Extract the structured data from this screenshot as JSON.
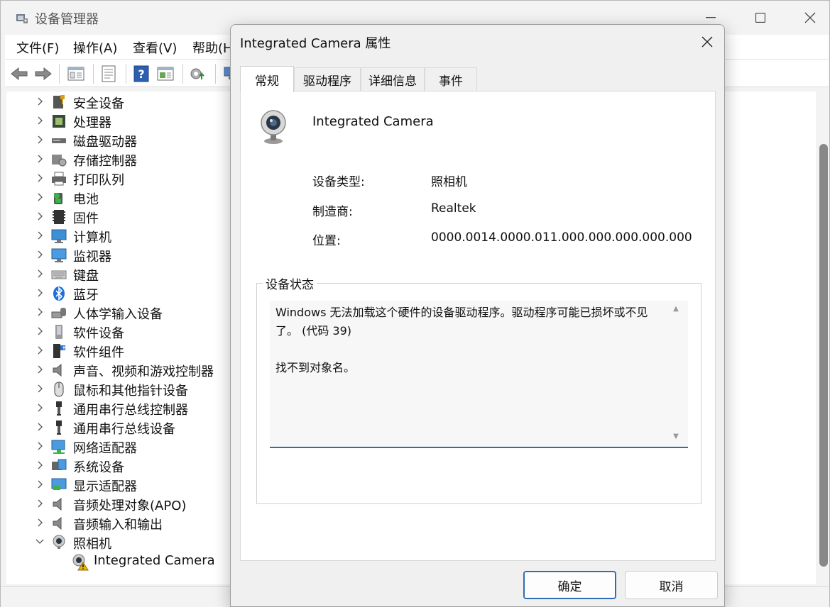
{
  "main_window": {
    "title": "设备管理器",
    "menu": [
      "文件(F)",
      "操作(A)",
      "查看(V)",
      "帮助(H)"
    ]
  },
  "tree": {
    "items": [
      {
        "label": "安全设备",
        "icon": "security-device-icon",
        "expanded": false
      },
      {
        "label": "处理器",
        "icon": "processor-icon",
        "expanded": false
      },
      {
        "label": "磁盘驱动器",
        "icon": "disk-drive-icon",
        "expanded": false
      },
      {
        "label": "存储控制器",
        "icon": "storage-controller-icon",
        "expanded": false
      },
      {
        "label": "打印队列",
        "icon": "printer-icon",
        "expanded": false
      },
      {
        "label": "电池",
        "icon": "battery-icon",
        "expanded": false
      },
      {
        "label": "固件",
        "icon": "firmware-icon",
        "expanded": false
      },
      {
        "label": "计算机",
        "icon": "computer-icon",
        "expanded": false
      },
      {
        "label": "监视器",
        "icon": "monitor-icon",
        "expanded": false
      },
      {
        "label": "键盘",
        "icon": "keyboard-icon",
        "expanded": false
      },
      {
        "label": "蓝牙",
        "icon": "bluetooth-icon",
        "expanded": false
      },
      {
        "label": "人体学输入设备",
        "icon": "hid-icon",
        "expanded": false
      },
      {
        "label": "软件设备",
        "icon": "software-device-icon",
        "expanded": false
      },
      {
        "label": "软件组件",
        "icon": "software-component-icon",
        "expanded": false
      },
      {
        "label": "声音、视频和游戏控制器",
        "icon": "speaker-icon",
        "expanded": false
      },
      {
        "label": "鼠标和其他指针设备",
        "icon": "mouse-icon",
        "expanded": false
      },
      {
        "label": "通用串行总线控制器",
        "icon": "usb-icon",
        "expanded": false
      },
      {
        "label": "通用串行总线设备",
        "icon": "usb-icon",
        "expanded": false
      },
      {
        "label": "网络适配器",
        "icon": "network-adapter-icon",
        "expanded": false
      },
      {
        "label": "系统设备",
        "icon": "system-device-icon",
        "expanded": false
      },
      {
        "label": "显示适配器",
        "icon": "display-adapter-icon",
        "expanded": false
      },
      {
        "label": "音频处理对象(APO)",
        "icon": "speaker-icon",
        "expanded": false
      },
      {
        "label": "音频输入和输出",
        "icon": "speaker-icon",
        "expanded": false
      },
      {
        "label": "照相机",
        "icon": "camera-icon",
        "expanded": true
      }
    ],
    "child": {
      "label": "Integrated Camera",
      "icon": "camera-warning-icon"
    }
  },
  "dialog": {
    "title": "Integrated Camera 属性",
    "tabs": [
      "常规",
      "驱动程序",
      "详细信息",
      "事件"
    ],
    "active_tab": "常规",
    "device_name": "Integrated Camera",
    "properties": {
      "type_label": "设备类型:",
      "type_value": "照相机",
      "manufacturer_label": "制造商:",
      "manufacturer_value": "Realtek",
      "location_label": "位置:",
      "location_value": "0000.0014.0000.011.000.000.000.000.000"
    },
    "status_title": "设备状态",
    "status_text": "Windows 无法加载这个硬件的设备驱动程序。驱动程序可能已损坏或不见了。 (代码 39)\n\n找不到对象名。",
    "ok_label": "确定",
    "cancel_label": "取消"
  },
  "colors": {
    "accent": "#2f6db3",
    "warning": "#f0b400"
  }
}
